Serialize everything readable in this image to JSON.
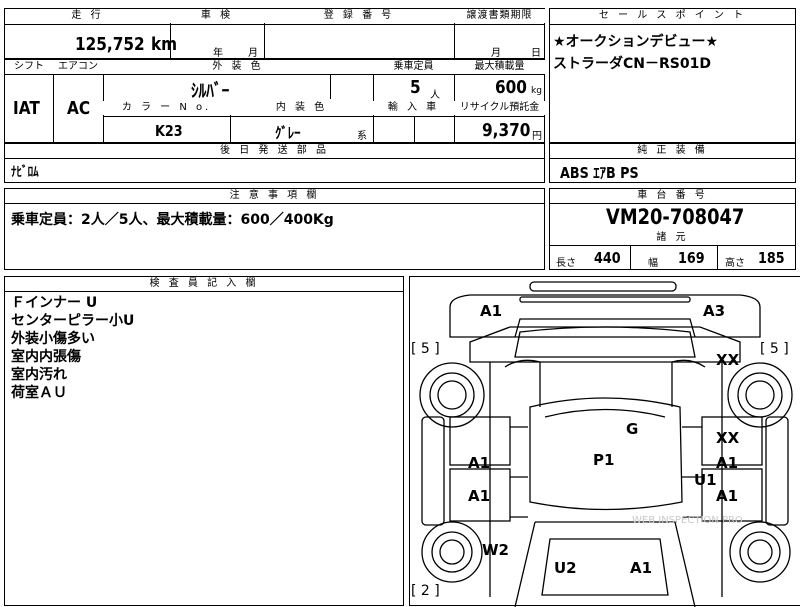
{
  "top": {
    "mileage_label": "走 行",
    "inspection_label": "車 検",
    "registration_label": "登 録 番 号",
    "transfer_label": "譲渡書類期限",
    "mileage_value": "125,752",
    "mileage_unit": "km",
    "year_label": "年",
    "month_label": "月",
    "transfer_month": "月",
    "transfer_day": "日"
  },
  "row2": {
    "shift_label": "シフト",
    "ac_label": "エアコン",
    "exterior_color_label": "外 装 色",
    "capacity_label": "乗車定員",
    "max_load_label": "最大積載量",
    "shift_value": "IAT",
    "ac_value": "AC",
    "exterior_color_value": "ｼﾙﾊﾞｰ",
    "capacity_value": "5",
    "capacity_unit": "人",
    "max_load_value": "600",
    "max_load_unit": "kg",
    "color_no_label": "カ ラ ー N o.",
    "interior_color_label": "内 装 色",
    "import_label": "輸 入 車",
    "recycle_label": "リサイクル預託金",
    "color_no_value": "K23",
    "interior_color_value": "ｸﾞﾚｰ",
    "interior_suffix": "系",
    "recycle_value": "9,370",
    "recycle_unit": "円"
  },
  "later_parts": {
    "label": "後 日 発 送 部 品",
    "value": "ﾅﾋﾞﾛﾑ"
  },
  "sales_point": {
    "label": "セ ー ル ス ポ イ ン ト",
    "line1": "★オークションデビュー★",
    "line2": "ストラーダCN－RS01D"
  },
  "standard_equipment": {
    "label": "純 正 装 備",
    "value": "ABS ｴｱB PS"
  },
  "notes": {
    "label": "注 意 事 項 欄",
    "value": "乗車定員：2人／5人、最大積載量：600／400Kg"
  },
  "chassis": {
    "label": "車 台 番 号",
    "value": "VM20-708047"
  },
  "specs": {
    "label": "諸 元",
    "length_label": "長さ",
    "length_value": "440",
    "width_label": "幅",
    "width_value": "169",
    "height_label": "高さ",
    "height_value": "185"
  },
  "inspector": {
    "label": "検 査 員 記 入 欄",
    "lines": [
      "Ｆインナー U",
      "センターピラー小U",
      "外装小傷多い",
      "室内内張傷",
      "室内汚れ",
      "荷室ＡＵ"
    ]
  },
  "diagram": {
    "marks": {
      "front_left": "A1",
      "front_right": "A3",
      "tire_fl": "[ 5 ]",
      "tire_fr": "[ 5 ]",
      "tire_rl": "[ 2 ]",
      "right_front_fender": "XX",
      "right_front_door_upper": "XX",
      "right_front_door": "A1",
      "right_rear_door_u1": "U1",
      "right_rear_door": "A1",
      "left_front_door": "A1",
      "left_rear_door": "A1",
      "left_rear_fender": "W2",
      "roof_g": "G",
      "roof_p1": "P1",
      "rear_u2": "U2",
      "rear_a1": "A1"
    },
    "watermark": "WEB INSPECTION PRO"
  }
}
